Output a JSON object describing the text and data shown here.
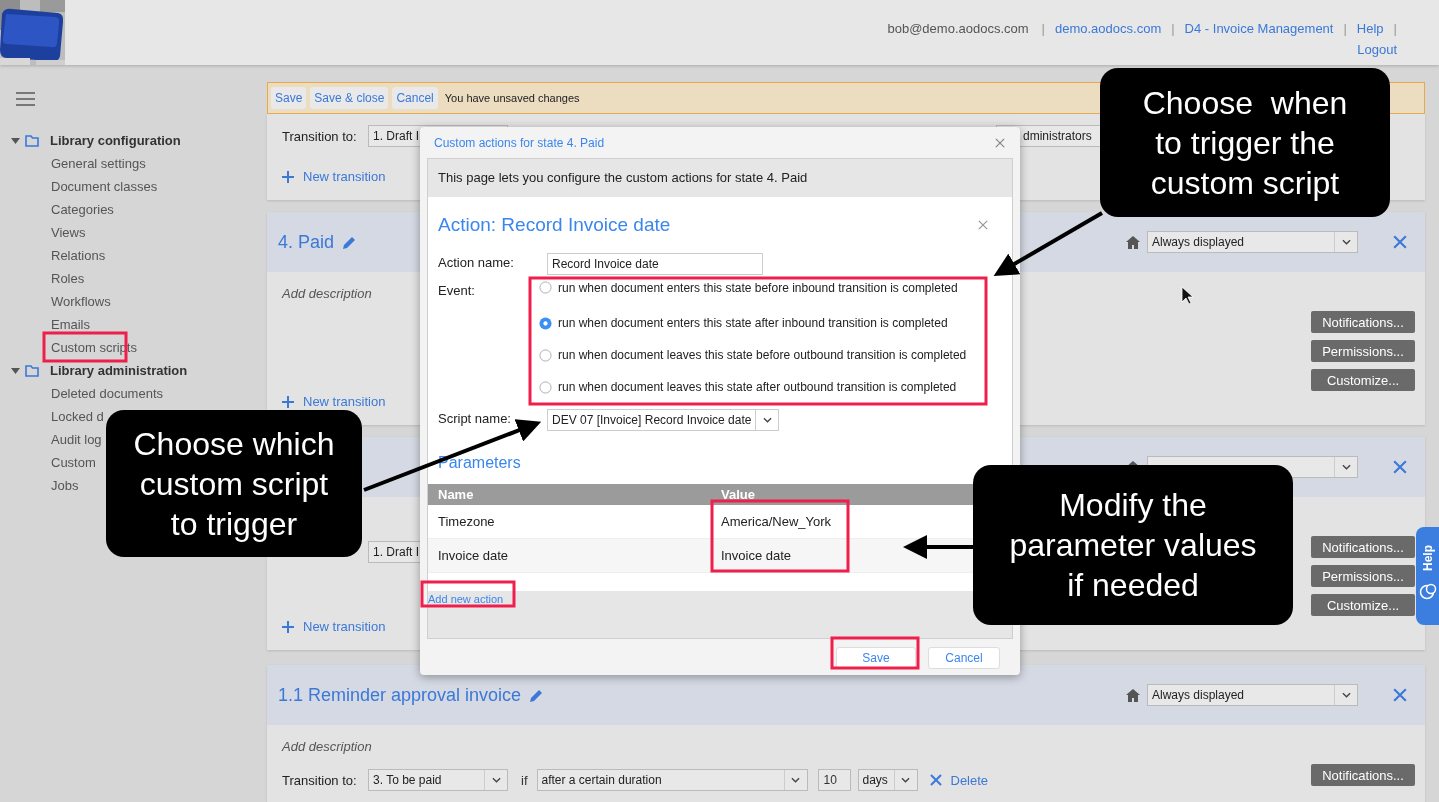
{
  "header": {
    "items": [
      {
        "kind": "text",
        "label": "bob@demo.aodocs.com"
      },
      {
        "kind": "separator",
        "label": "|"
      },
      {
        "kind": "link",
        "label": "demo.aodocs.com"
      },
      {
        "kind": "separator",
        "label": "|"
      },
      {
        "kind": "link",
        "label": "D4 - Invoice Management"
      },
      {
        "kind": "separator",
        "label": "|"
      },
      {
        "kind": "link",
        "label": "Help"
      },
      {
        "kind": "separator",
        "label": "|"
      },
      {
        "kind": "link",
        "label": "Logout"
      }
    ]
  },
  "sidebar": {
    "sections": [
      {
        "label": "Library configuration",
        "expanded": true,
        "children": [
          {
            "label": "General settings"
          },
          {
            "label": "Document classes"
          },
          {
            "label": "Categories"
          },
          {
            "label": "Views"
          },
          {
            "label": "Relations"
          },
          {
            "label": "Roles"
          },
          {
            "label": "Workflows"
          },
          {
            "label": "Emails"
          },
          {
            "label": "Custom scripts"
          }
        ]
      },
      {
        "label": "Library administration",
        "expanded": true,
        "children": [
          {
            "label": "Deleted documents"
          },
          {
            "label": "Locked d"
          },
          {
            "label": "Audit log"
          },
          {
            "label": "Custom"
          },
          {
            "label": "Jobs"
          }
        ]
      }
    ]
  },
  "toolbar": {
    "buttons": [
      "Save",
      "Save & close",
      "Cancel"
    ],
    "message": "You have unsaved changes"
  },
  "states": [
    {
      "kind": "continued",
      "transitions": [
        {
          "label": "Transition to:",
          "target": "1. Draft I",
          "role": "dministrators"
        }
      ],
      "new_transition": "New transition"
    },
    {
      "kind": "state",
      "title": "4. Paid",
      "visibility": "Always displayed",
      "description": "Add description",
      "buttons": [
        "Notifications...",
        "Permissions...",
        "Customize..."
      ],
      "new_transition": "New transition"
    },
    {
      "kind": "state",
      "transitions": [
        {
          "target": "1. Draft I"
        }
      ],
      "buttons": [
        "Notifications...",
        "Permissions...",
        "Customize..."
      ],
      "new_transition": "New transition"
    },
    {
      "kind": "state",
      "title": "1.1 Reminder approval invoice",
      "visibility": "Always displayed",
      "description": "Add description",
      "transitions": [
        {
          "label": "Transition to:",
          "target": "3. To be paid",
          "condition_word": "if",
          "condition": "after a certain duration",
          "amount": "10",
          "unit": "days",
          "delete": "Delete"
        }
      ],
      "buttons": [
        "Notifications..."
      ]
    }
  ],
  "dialog": {
    "title": "Custom actions for state 4. Paid",
    "intro": "This page lets you configure the custom actions for state 4. Paid",
    "action_title": "Action: Record Invoice date",
    "action_name_label": "Action name:",
    "action_name": "Record Invoice date",
    "event_label": "Event:",
    "events": [
      {
        "label": "run when document enters this state before inbound transition is completed",
        "selected": false
      },
      {
        "label": "run when document enters this state after inbound transition is completed",
        "selected": true
      },
      {
        "label": "run when document leaves this state before outbound transition is completed",
        "selected": false
      },
      {
        "label": "run when document leaves this state after outbound transition is completed",
        "selected": false
      }
    ],
    "script_label": "Script name:",
    "script": "DEV 07 [Invoice] Record Invoice date",
    "parameters_title": "Parameters",
    "columns": [
      "Name",
      "Value"
    ],
    "parameters": [
      {
        "name": "Timezone",
        "value": "America/New_York"
      },
      {
        "name": "Invoice date",
        "value": "Invoice date"
      }
    ],
    "add_action": "Add new action",
    "buttons": [
      "Save",
      "Cancel"
    ]
  },
  "callouts": [
    {
      "lines": [
        "Choose  when",
        "to trigger the",
        "custom script"
      ]
    },
    {
      "lines": [
        "Choose which",
        "custom script",
        "to trigger"
      ]
    },
    {
      "lines": [
        "Modify the",
        "parameter values",
        "if needed"
      ]
    }
  ],
  "help_tab": {
    "label": "Help"
  }
}
